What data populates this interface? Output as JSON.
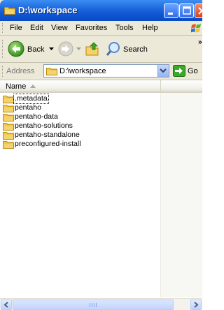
{
  "window": {
    "title": "D:\\workspace"
  },
  "menu": {
    "items": [
      "File",
      "Edit",
      "View",
      "Favorites",
      "Tools",
      "Help"
    ]
  },
  "toolbar": {
    "back_label": "Back",
    "search_label": "Search",
    "overflow_label": "»"
  },
  "address": {
    "label": "Address",
    "value": "D:\\workspace",
    "go_label": "Go"
  },
  "list": {
    "column_name": "Name",
    "items": [
      ".metadata",
      "pentaho",
      "pentaho-data",
      "pentaho-solutions",
      "pentaho-standalone",
      "preconfigured-install"
    ]
  },
  "colors": {
    "title_bar": "#0f56d2",
    "folder": "#f5d36b",
    "chrome": "#ece9d8"
  },
  "icons": [
    "folder-icon",
    "back-arrow-icon",
    "forward-arrow-icon",
    "up-folder-icon",
    "search-icon",
    "go-arrow-icon",
    "windows-logo-icon"
  ]
}
